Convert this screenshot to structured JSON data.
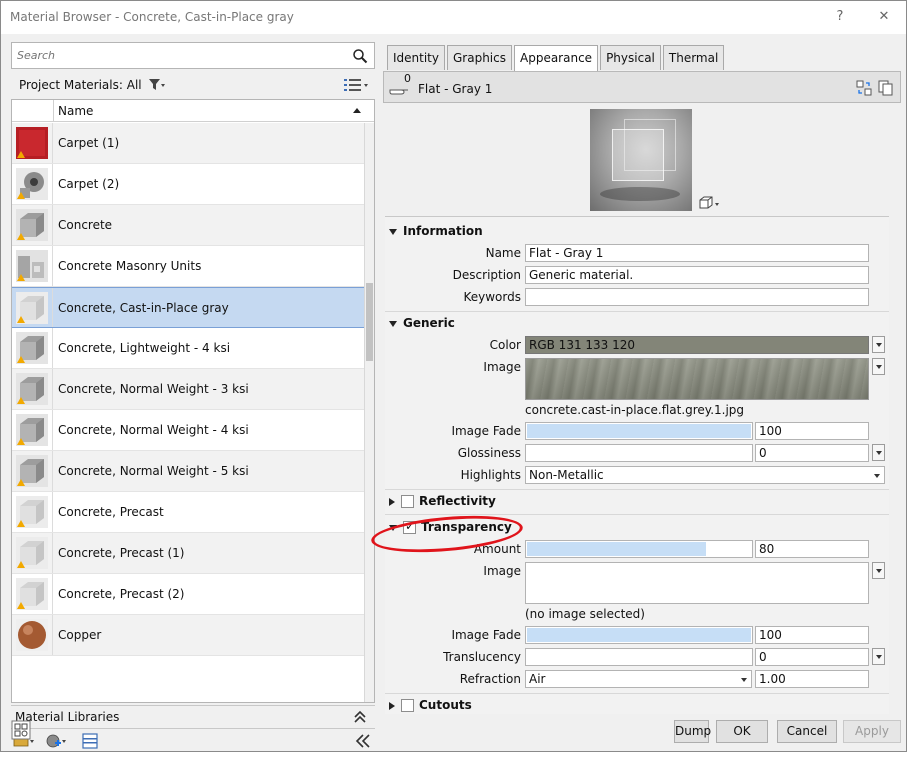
{
  "window": {
    "title": "Material Browser - Concrete, Cast-in-Place gray",
    "help_label": "?",
    "close_label": "✕"
  },
  "left": {
    "search_placeholder": "Search",
    "project_materials_label": "Project Materials: All",
    "column_name": "Name",
    "materials": [
      {
        "name": "Carpet (1)",
        "thumb": "red-carpet"
      },
      {
        "name": "Carpet (2)",
        "thumb": "gray-sphere"
      },
      {
        "name": "Concrete",
        "thumb": "gray-cube"
      },
      {
        "name": "Concrete Masonry Units",
        "thumb": "masonry"
      },
      {
        "name": "Concrete, Cast-in-Place gray",
        "thumb": "light-cube",
        "selected": true
      },
      {
        "name": "Concrete, Lightweight - 4 ksi",
        "thumb": "gray-cube"
      },
      {
        "name": "Concrete, Normal Weight - 3 ksi",
        "thumb": "gray-cube"
      },
      {
        "name": "Concrete, Normal Weight - 4 ksi",
        "thumb": "gray-cube"
      },
      {
        "name": "Concrete, Normal Weight - 5 ksi",
        "thumb": "gray-cube"
      },
      {
        "name": "Concrete, Precast",
        "thumb": "light-cube"
      },
      {
        "name": "Concrete, Precast (1)",
        "thumb": "light-cube"
      },
      {
        "name": "Concrete, Precast (2)",
        "thumb": "light-cube"
      },
      {
        "name": "Copper",
        "thumb": "copper-sphere"
      }
    ],
    "material_libraries_label": "Material Libraries"
  },
  "right": {
    "tabs": [
      "Identity",
      "Graphics",
      "Appearance",
      "Physical",
      "Thermal"
    ],
    "active_tab": "Appearance",
    "asset_count": "0",
    "asset_name": "Flat - Gray 1",
    "information": {
      "header": "Information",
      "name_label": "Name",
      "name_value": "Flat - Gray 1",
      "description_label": "Description",
      "description_value": "Generic material.",
      "keywords_label": "Keywords",
      "keywords_value": ""
    },
    "generic": {
      "header": "Generic",
      "color_label": "Color",
      "color_value": "RGB 131 133 120",
      "color_hex": "#838578",
      "image_label": "Image",
      "image_file": "concrete.cast-in-place.flat.grey.1.jpg",
      "image_fade_label": "Image Fade",
      "image_fade_value": "100",
      "image_fade_fraction": 1.0,
      "glossiness_label": "Glossiness",
      "glossiness_value": "0",
      "glossiness_fraction": 0.0,
      "highlights_label": "Highlights",
      "highlights_value": "Non-Metallic"
    },
    "reflectivity": {
      "header": "Reflectivity",
      "checked": false
    },
    "transparency": {
      "header": "Transparency",
      "checked": true,
      "amount_label": "Amount",
      "amount_value": "80",
      "amount_fraction": 0.8,
      "image_label": "Image",
      "image_caption": "(no image selected)",
      "image_fade_label": "Image Fade",
      "image_fade_value": "100",
      "image_fade_fraction": 1.0,
      "translucency_label": "Translucency",
      "translucency_value": "0",
      "translucency_fraction": 0.0,
      "refraction_label": "Refraction",
      "refraction_select": "Air",
      "refraction_value": "1.00"
    },
    "cutouts": {
      "header": "Cutouts",
      "checked": false
    }
  },
  "buttons": {
    "dump": "Dump",
    "ok": "OK",
    "cancel": "Cancel",
    "apply": "Apply"
  },
  "annotation_color": "#e0141b"
}
